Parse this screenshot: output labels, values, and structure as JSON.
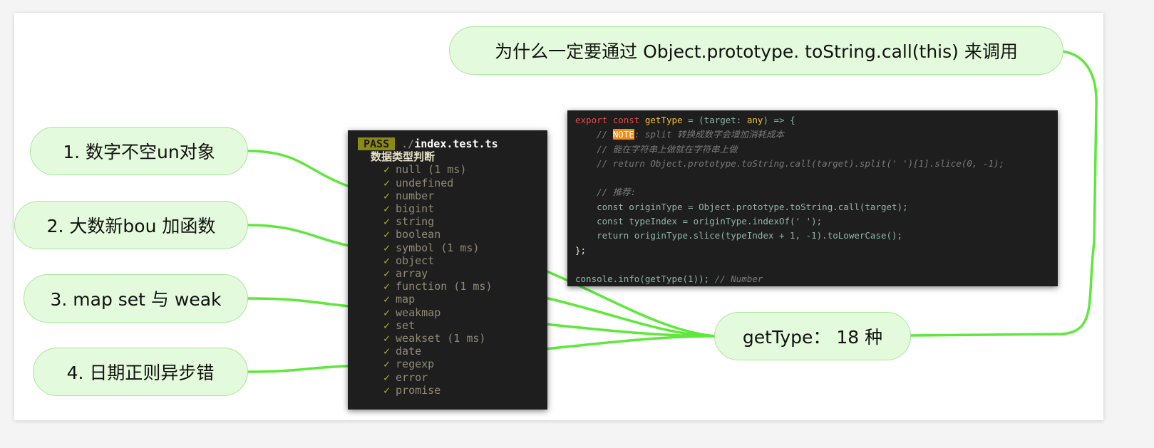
{
  "nodes": {
    "top": "为什么一定要通过 Object.prototype. toString.call(this) 来调用",
    "n1": "1. 数字不空un对象",
    "n2": "2. 大数新bou 加函数",
    "n3": "3. map set 与 weak",
    "n4": "4. 日期正则异步错",
    "center": "getType： 18 种"
  },
  "terminal": {
    "status": "PASS",
    "file_dir": "./",
    "file_name": "index.test.ts",
    "suite": "数据类型判断",
    "tests": [
      "null (1 ms)",
      "undefined",
      "number",
      "bigint",
      "string",
      "boolean",
      "symbol (1 ms)",
      "object",
      "array",
      "function (1 ms)",
      "map",
      "weakmap",
      "set",
      "weakset (1 ms)",
      "date",
      "regexp",
      "error",
      "promise"
    ]
  },
  "code": {
    "l1": [
      "export",
      "const",
      "getType",
      " = (target: ",
      "any",
      ") => {"
    ],
    "l2_note": "NOTE",
    "l2_rest": ": split 转换成数字会增加消耗成本",
    "l3": "// 能在字符串上做就在字符串上做",
    "l4": "// return Object.prototype.toString.call(target).split(' ')[1].slice(0, -1);",
    "l6": "// 推荐:",
    "l7": "const originType = Object.prototype.toString.call(target);",
    "l8": "const typeIndex = originType.indexOf(' ');",
    "l9": "return originType.slice(typeIndex + 1, -1).toLowerCase();",
    "l10": "};",
    "l12": "console.info(getType(1));",
    "l12_comment": "// Number"
  },
  "colors": {
    "link": "#5ee83c",
    "node_fill": "#e4fadc",
    "node_border": "#a6e898"
  }
}
